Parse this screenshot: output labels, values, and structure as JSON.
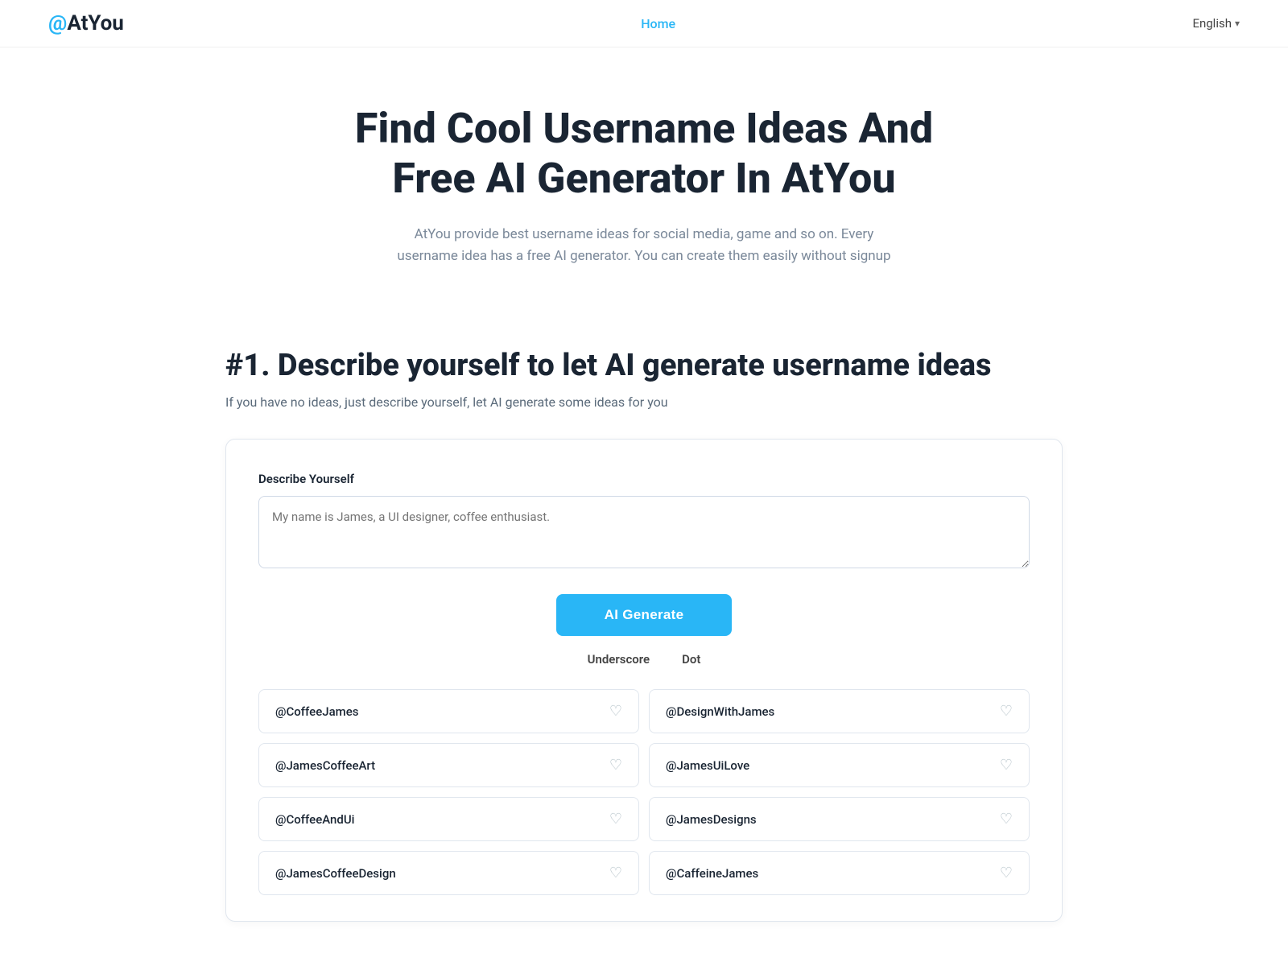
{
  "header": {
    "logo_at": "@",
    "logo_text": "AtYou",
    "nav_home": "Home",
    "lang_label": "English"
  },
  "hero": {
    "title": "Find Cool Username Ideas And Free AI Generator In AtYou",
    "subtitle": "AtYou provide best username ideas for social media, game and so on. Every username idea has a free AI generator. You can create them easily without signup"
  },
  "section1": {
    "title": "#1. Describe yourself to let AI generate username ideas",
    "desc": "If you have no ideas, just describe yourself, let AI generate some ideas for you"
  },
  "form": {
    "label": "Describe Yourself",
    "placeholder": "My name is James, a UI designer, coffee enthusiast.",
    "generate_btn": "AI Generate",
    "option_underscore": "Underscore",
    "option_dot": "Dot"
  },
  "usernames": [
    {
      "name": "@CoffeeJames",
      "side": "left"
    },
    {
      "name": "@DesignWithJames",
      "side": "right"
    },
    {
      "name": "@JamesCoffeeArt",
      "side": "left"
    },
    {
      "name": "@JamesUiLove",
      "side": "right"
    },
    {
      "name": "@CoffeeAndUi",
      "side": "left"
    },
    {
      "name": "@JamesDesigns",
      "side": "right"
    },
    {
      "name": "@JamesCoffeeDesign",
      "side": "left"
    },
    {
      "name": "@CaffeineJames",
      "side": "right"
    }
  ],
  "colors": {
    "accent": "#29b6f6",
    "title": "#1a2533",
    "muted": "#7a8899"
  }
}
